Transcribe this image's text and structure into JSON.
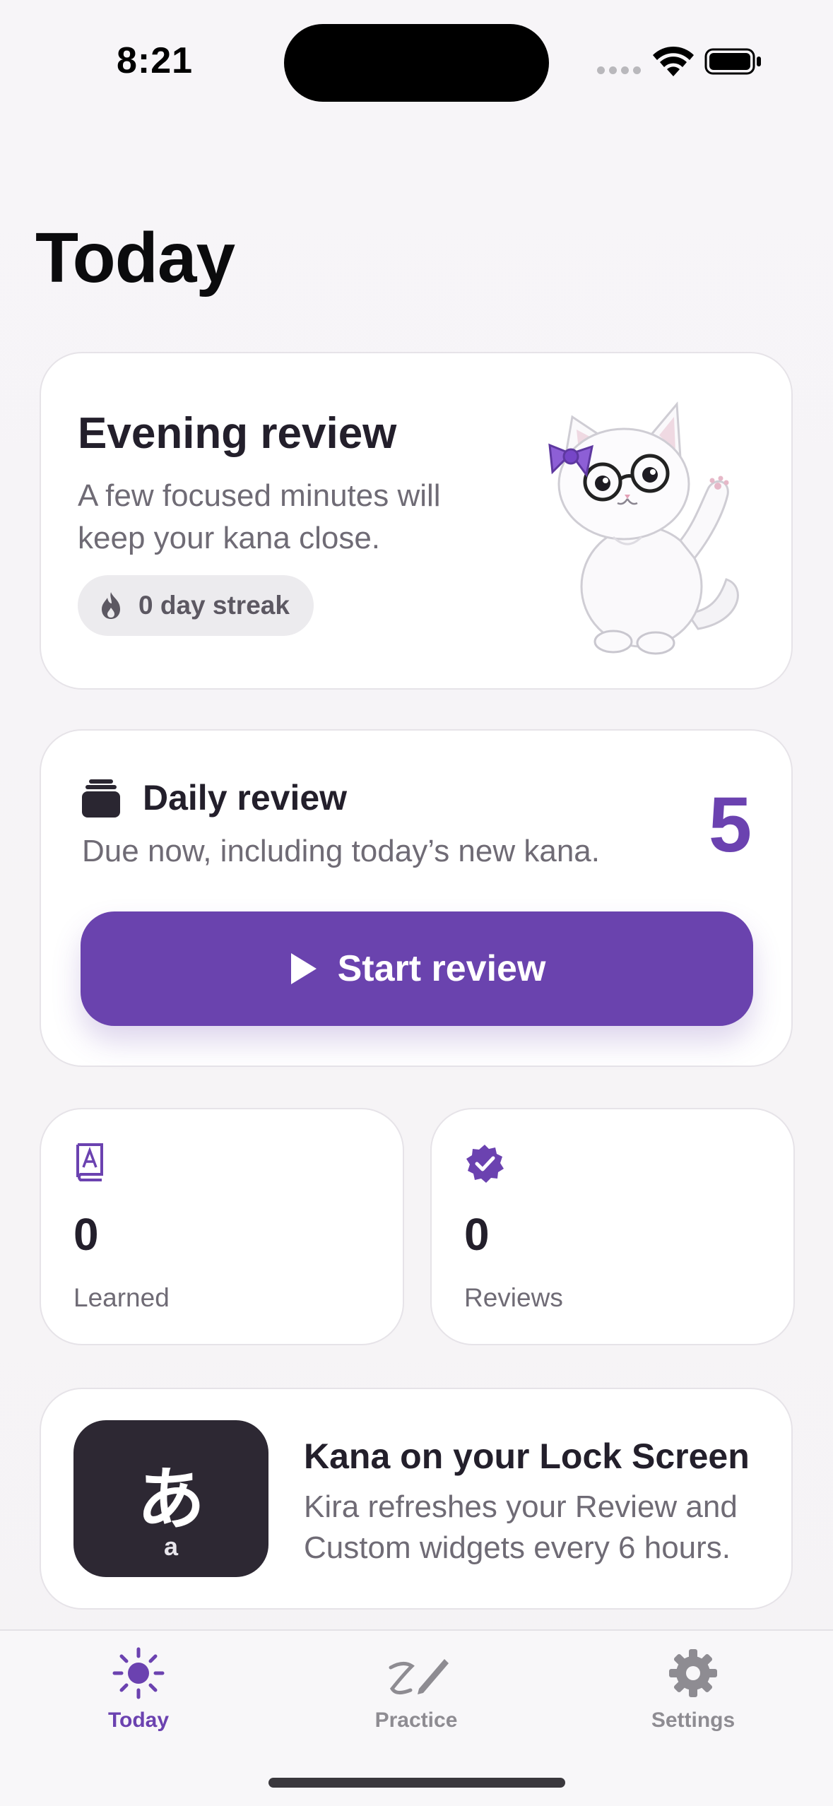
{
  "status_bar": {
    "time": "8:21"
  },
  "page": {
    "title": "Today"
  },
  "evening_card": {
    "title": "Evening review",
    "subtitle": "A few focused minutes will keep your kana close.",
    "streak_label": "0 day streak",
    "mascot_icon": "cat-mascot-illustration"
  },
  "daily_review": {
    "icon": "stack-icon",
    "title": "Daily review",
    "subtitle": "Due now, including today’s new kana.",
    "count": "5",
    "button_label": "Start review",
    "button_icon": "play-icon"
  },
  "stats": [
    {
      "icon": "book-icon",
      "value": "0",
      "label": "Learned"
    },
    {
      "icon": "verified-badge-icon",
      "value": "0",
      "label": "Reviews"
    }
  ],
  "lock_screen": {
    "kana": "あ",
    "romaji": "a",
    "title": "Kana on your Lock Screen",
    "subtitle": "Kira refreshes your Review and Custom widgets every 6 hours."
  },
  "tabs": [
    {
      "label": "Today",
      "icon": "sun-icon",
      "selected": true
    },
    {
      "label": "Practice",
      "icon": "handwriting-pencil-icon",
      "selected": false
    },
    {
      "label": "Settings",
      "icon": "gear-icon",
      "selected": false
    }
  ],
  "colors": {
    "accent": "#6a43ae",
    "card": "#ffffff",
    "background": "#f6f4f6",
    "tile": "#2d2833"
  }
}
